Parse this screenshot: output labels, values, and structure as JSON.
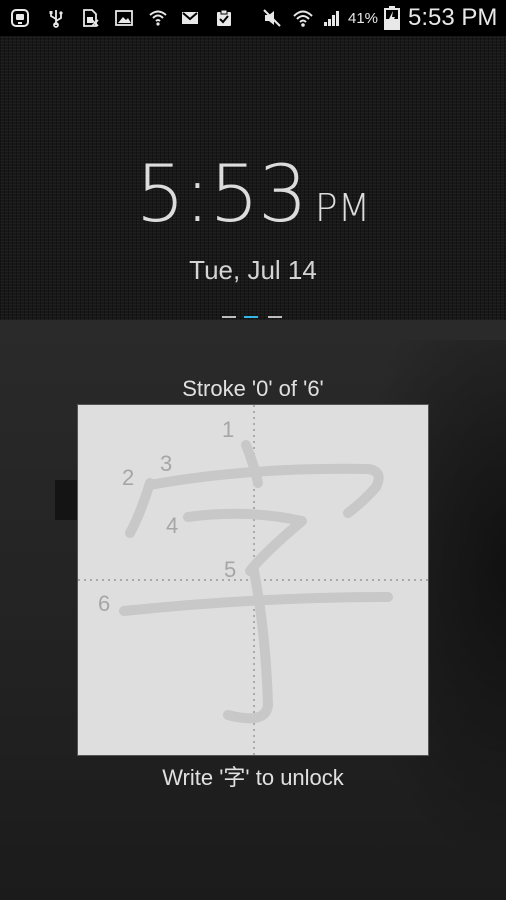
{
  "status_bar": {
    "battery_percent": "41%",
    "time": "5:53 PM",
    "left_icons": [
      "talk-icon",
      "usb-icon",
      "sim-icon",
      "image-icon",
      "shield-wifi-icon",
      "gmail-icon",
      "clipboard-check-icon"
    ],
    "right_icons": [
      "mute-icon",
      "wifi-icon",
      "signal-icon",
      "battery-charging-icon"
    ]
  },
  "lockscreen": {
    "time": "5:53",
    "ampm": "PM",
    "date": "Tue, Jul 14",
    "pager_active_index": 1,
    "accent_color": "#33b5e5"
  },
  "puzzle": {
    "stroke_status": "Stroke '0' of '6'",
    "character": "字",
    "stroke_numbers": [
      "1",
      "2",
      "3",
      "4",
      "5",
      "6"
    ],
    "instruction": "Write '字' to unlock"
  }
}
